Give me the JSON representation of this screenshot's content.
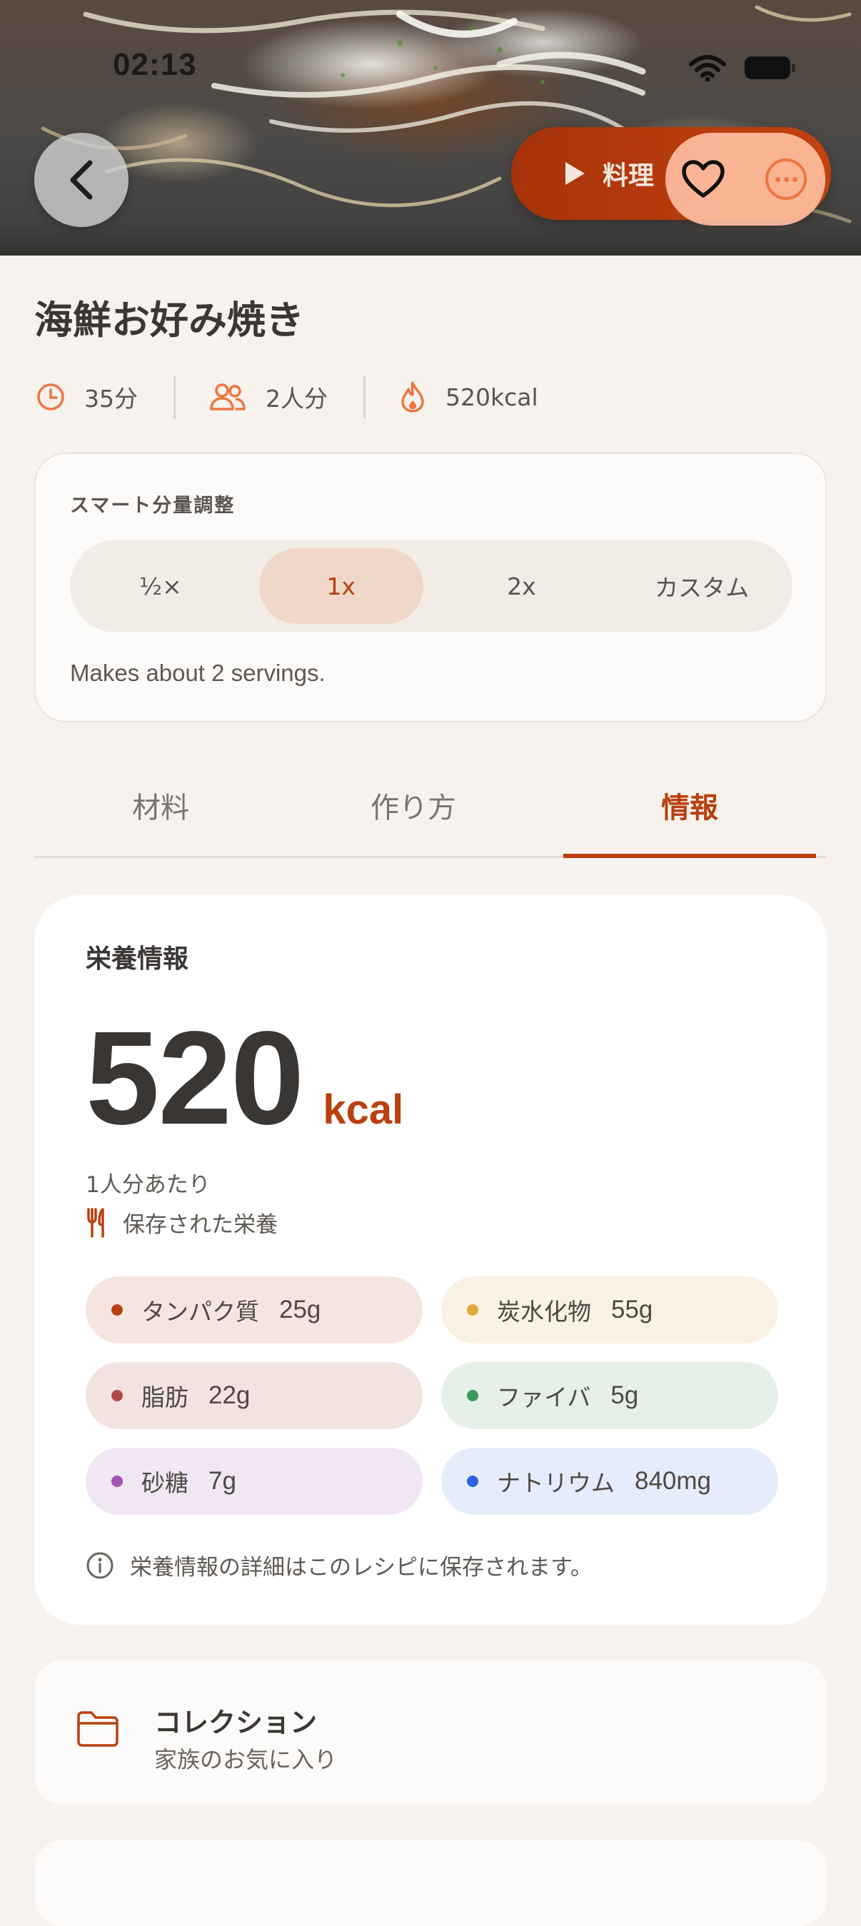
{
  "status_bar": {
    "time": "02:13"
  },
  "header": {
    "cook_button_label": "料理"
  },
  "recipe": {
    "title": "海鮮お好み焼き",
    "meta": {
      "time": "35分",
      "servings": "2人分",
      "calories": "520kcal"
    }
  },
  "scaling": {
    "title": "スマート分量調整",
    "options": [
      "½×",
      "1x",
      "2x",
      "カスタム"
    ],
    "selected": "1x",
    "note": "Makes about 2 servings."
  },
  "tabs": {
    "items": [
      "材料",
      "作り方",
      "情報"
    ],
    "active": "情報"
  },
  "nutrition": {
    "title": "栄養情報",
    "calories": "520",
    "unit": "kcal",
    "per_serving": "1人分あたり",
    "saved_label": "保存された栄養",
    "nutrients": [
      {
        "name": "タンパク質",
        "value": "25g",
        "dot": "#b8411a",
        "bg": "#f6e5de"
      },
      {
        "name": "炭水化物",
        "value": "55g",
        "dot": "#dfa83a",
        "bg": "#fbf1e2"
      },
      {
        "name": "脂肪",
        "value": "22g",
        "dot": "#b3474a",
        "bg": "#f3e3e0"
      },
      {
        "name": "ファイバ",
        "value": "5g",
        "dot": "#3d9a5c",
        "bg": "#e5f1e8"
      },
      {
        "name": "砂糖",
        "value": "7g",
        "dot": "#a154b1",
        "bg": "#f1e6f3"
      },
      {
        "name": "ナトリウム",
        "value": "840mg",
        "dot": "#2f63e2",
        "bg": "#e5ecfb"
      }
    ],
    "footer": "栄養情報の詳細はこのレシピに保存されます。"
  },
  "collection": {
    "title": "コレクション",
    "subtitle": "家族のお気に入り"
  },
  "colors": {
    "accent": "#b8410f",
    "accent_light": "#ee7540",
    "background": "#f7f2ee"
  }
}
